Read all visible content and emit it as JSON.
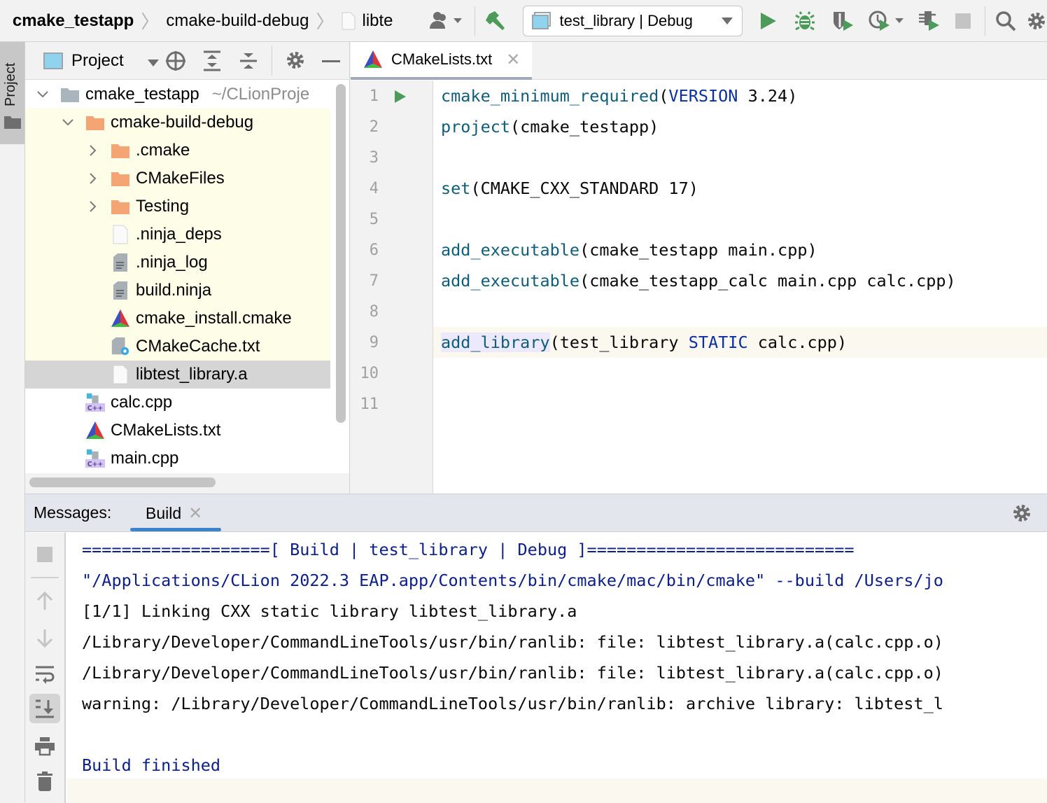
{
  "toolbar": {
    "breadcrumbs": [
      "cmake_testapp",
      "cmake-build-debug",
      "libte"
    ],
    "run_config": "test_library | Debug",
    "icons": [
      "user-icon",
      "build-hammer-icon",
      "run-icon",
      "debug-icon",
      "coverage-icon",
      "profile-icon",
      "attach-icon",
      "stop-icon",
      "search-icon",
      "settings-icon"
    ]
  },
  "left_stripe": {
    "project_label": "Project"
  },
  "project_panel": {
    "title": "Project",
    "tree": [
      {
        "label": "cmake_testapp",
        "sub": "~/CLionProje",
        "icon": "folder-gray",
        "expanded": true,
        "depth": 0,
        "highlight": "none"
      },
      {
        "label": "cmake-build-debug",
        "icon": "folder-orange",
        "expanded": true,
        "depth": 1,
        "highlight": "yellow"
      },
      {
        "label": ".cmake",
        "icon": "folder-orange",
        "expanded": false,
        "depth": 2,
        "highlight": "yellow"
      },
      {
        "label": "CMakeFiles",
        "icon": "folder-orange",
        "expanded": false,
        "depth": 2,
        "highlight": "yellow"
      },
      {
        "label": "Testing",
        "icon": "folder-orange",
        "expanded": false,
        "depth": 2,
        "highlight": "yellow"
      },
      {
        "label": ".ninja_deps",
        "icon": "file-blank",
        "depth": 2,
        "highlight": "yellow"
      },
      {
        "label": ".ninja_log",
        "icon": "file-text",
        "depth": 2,
        "highlight": "yellow"
      },
      {
        "label": "build.ninja",
        "icon": "file-text",
        "depth": 2,
        "highlight": "yellow"
      },
      {
        "label": "cmake_install.cmake",
        "icon": "cmake",
        "depth": 2,
        "highlight": "yellow"
      },
      {
        "label": "CMakeCache.txt",
        "icon": "file-config",
        "depth": 2,
        "highlight": "yellow"
      },
      {
        "label": "libtest_library.a",
        "icon": "file-blank",
        "depth": 2,
        "highlight": "selected"
      },
      {
        "label": "calc.cpp",
        "icon": "cpp",
        "depth": 1,
        "highlight": "none"
      },
      {
        "label": "CMakeLists.txt",
        "icon": "cmake",
        "depth": 1,
        "highlight": "none"
      },
      {
        "label": "main.cpp",
        "icon": "cpp",
        "depth": 1,
        "highlight": "none"
      }
    ]
  },
  "editor": {
    "tab": {
      "label": "CMakeLists.txt"
    },
    "line_numbers": [
      "1",
      "2",
      "3",
      "4",
      "5",
      "6",
      "7",
      "8",
      "9",
      "10",
      "11"
    ],
    "current_line": 9,
    "lines": [
      [
        {
          "t": "cmake_minimum_required",
          "c": "kw"
        },
        {
          "t": "("
        },
        {
          "t": "VERSION",
          "c": "cst"
        },
        {
          "t": " 3.24)"
        }
      ],
      [
        {
          "t": "project",
          "c": "kw"
        },
        {
          "t": "(cmake_testapp)"
        }
      ],
      [],
      [
        {
          "t": "set",
          "c": "kw"
        },
        {
          "t": "(CMAKE_CXX_STANDARD 17)"
        }
      ],
      [],
      [
        {
          "t": "add_executable",
          "c": "kw"
        },
        {
          "t": "(cmake_testapp main.cpp)"
        }
      ],
      [
        {
          "t": "add_executable",
          "c": "kw"
        },
        {
          "t": "(cmake_testapp_calc main.cpp calc.cpp)"
        }
      ],
      [],
      [
        {
          "t": "add_library",
          "c": "kw hl"
        },
        {
          "t": "(test_library "
        },
        {
          "t": "STATIC",
          "c": "cst"
        },
        {
          "t": " calc.cpp)"
        }
      ],
      [],
      []
    ]
  },
  "messages": {
    "label": "Messages:",
    "tab": "Build",
    "console": [
      {
        "text": "===================[ Build | test_library | Debug ]===========================",
        "style": "blue"
      },
      {
        "text": "\"/Applications/CLion 2022.3 EAP.app/Contents/bin/cmake/mac/bin/cmake\" --build /Users/jo",
        "style": "blue"
      },
      {
        "text": "[1/1] Linking CXX static library libtest_library.a",
        "style": "normal"
      },
      {
        "text": "/Library/Developer/CommandLineTools/usr/bin/ranlib: file: libtest_library.a(calc.cpp.o)",
        "style": "normal"
      },
      {
        "text": "/Library/Developer/CommandLineTools/usr/bin/ranlib: file: libtest_library.a(calc.cpp.o)",
        "style": "normal"
      },
      {
        "text": "warning: /Library/Developer/CommandLineTools/usr/bin/ranlib: archive library: libtest_l",
        "style": "normal"
      },
      {
        "text": "",
        "style": "normal"
      },
      {
        "text": "Build finished",
        "style": "blue"
      }
    ],
    "side_actions": [
      "stop",
      "previous",
      "next",
      "soft-wrap",
      "scroll-to-end",
      "print",
      "clear"
    ]
  }
}
